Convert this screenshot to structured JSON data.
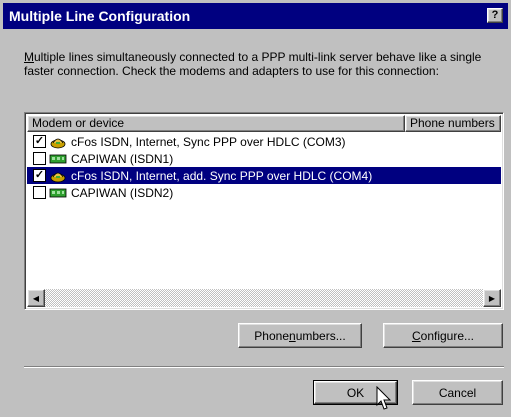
{
  "window": {
    "title": "Multiple Line Configuration",
    "help_button": "?"
  },
  "description": {
    "prefix_underlined": "M",
    "text": "ultiple lines simultaneously connected to a PPP multi-link server behave like a single faster connection.  Check the modems and adapters to use for this connection:"
  },
  "list": {
    "columns": [
      "Modem or device",
      "Phone numbers"
    ],
    "rows": [
      {
        "checked": true,
        "icon": "modem-icon",
        "label": "cFos ISDN, Internet, Sync PPP over HDLC (COM3)",
        "selected": false
      },
      {
        "checked": false,
        "icon": "isdn-card-icon",
        "label": "CAPIWAN (ISDN1)",
        "selected": false
      },
      {
        "checked": true,
        "icon": "modem-icon",
        "label": "cFos ISDN, Internet, add. Sync PPP over HDLC (COM4)",
        "selected": true
      },
      {
        "checked": false,
        "icon": "isdn-card-icon",
        "label": "CAPIWAN (ISDN2)",
        "selected": false
      }
    ]
  },
  "buttons": {
    "phone_numbers_pre": "Phone ",
    "phone_numbers_ul": "n",
    "phone_numbers_post": "umbers...",
    "configure_ul": "C",
    "configure_post": "onfigure...",
    "ok": "OK",
    "cancel": "Cancel"
  },
  "colors": {
    "title_bar": "#000080",
    "selection": "#000080",
    "face": "#c0c0c0"
  }
}
